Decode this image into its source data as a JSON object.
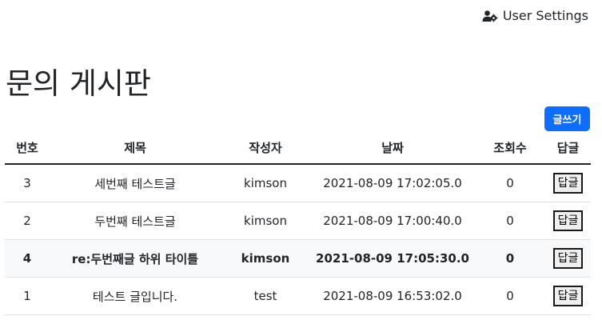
{
  "header": {
    "user_settings_label": "User Settings",
    "user_settings_icon": "users-cog-icon"
  },
  "page_title": "문의 게시판",
  "write_button_label": "글쓰기",
  "colors": {
    "primary": "#0d6efd",
    "text": "#212529",
    "row_highlight": "#f8f9fa"
  },
  "table": {
    "columns": [
      "번호",
      "제목",
      "작성자",
      "날짜",
      "조회수",
      "답글"
    ],
    "rows": [
      {
        "no": "3",
        "title": "세번째 테스트글",
        "author": "kimson",
        "date": "2021-08-09 17:02:05.0",
        "views": "0",
        "reply": "답글",
        "highlight": false
      },
      {
        "no": "2",
        "title": "두번째 테스트글",
        "author": "kimson",
        "date": "2021-08-09 17:00:40.0",
        "views": "0",
        "reply": "답글",
        "highlight": false
      },
      {
        "no": "4",
        "title": "re:두번째글 하위 타이틀",
        "author": "kimson",
        "date": "2021-08-09 17:05:30.0",
        "views": "0",
        "reply": "답글",
        "highlight": true
      },
      {
        "no": "1",
        "title": "테스트 글입니다.",
        "author": "test",
        "date": "2021-08-09 16:53:02.0",
        "views": "0",
        "reply": "답글",
        "highlight": false
      }
    ]
  }
}
